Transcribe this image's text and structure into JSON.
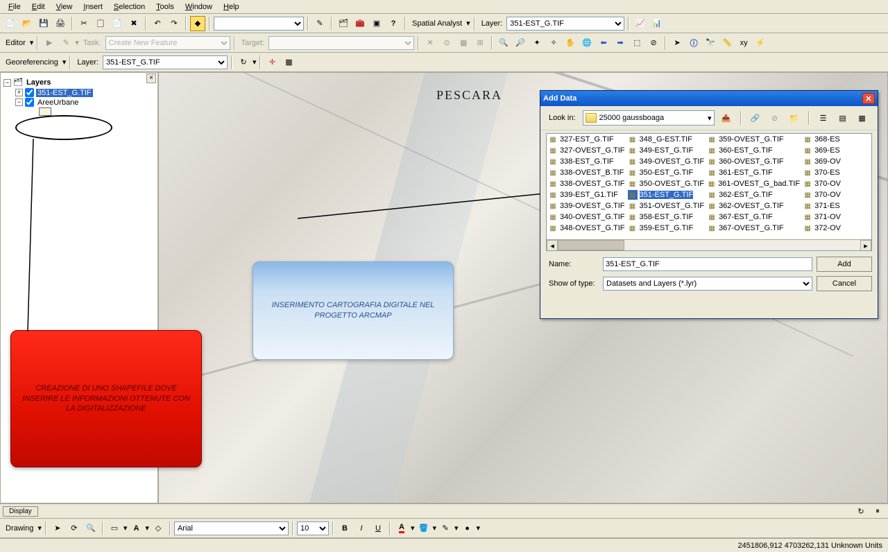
{
  "menu": {
    "file": "File",
    "edit": "Edit",
    "view": "View",
    "insert": "Insert",
    "selection": "Selection",
    "tools": "Tools",
    "window": "Window",
    "help": "Help"
  },
  "toolbar1": {
    "spatial_analyst": "Spatial Analyst",
    "layer_label": "Layer:",
    "layer_value": "351-EST_G.TIF"
  },
  "toolbar2": {
    "editor": "Editor",
    "task": "Task:",
    "task_value": "Create New Feature",
    "target": "Target:"
  },
  "toolbar3": {
    "georef": "Georeferencing",
    "layer_label": "Layer:",
    "layer_value": "351-EST_G.TIF"
  },
  "toc": {
    "root": "Layers",
    "item1": "351-EST_G.TIF",
    "item2": "AreeUrbane"
  },
  "map": {
    "city": "PESCARA"
  },
  "callout_blue": "INSERIMENTO CARTOGRAFIA DIGITALE NEL PROGETTO ARCMAP",
  "callout_red": "CREAZIONE DI UNO SHAPEFILE DOVE INSERIRE LE INFORMAZIONI OTTENUTE CON LA DIGITALIZZAZIONE",
  "dialog": {
    "title": "Add Data",
    "lookin": "Look in:",
    "folder": "25000 gaussboaga",
    "name_label": "Name:",
    "name_value": "351-EST_G.TIF",
    "type_label": "Show of type:",
    "type_value": "Datasets and Layers (*.lyr)",
    "add": "Add",
    "cancel": "Cancel",
    "files": [
      [
        "327-EST_G.TIF",
        "327-OVEST_G.TIF",
        "338-EST_G.TIF",
        "338-OVEST_B.TIF",
        "338-OVEST_G.TIF",
        "339-EST_G1.TIF",
        "339-OVEST_G.TIF",
        "340-OVEST_G.TIF",
        "348-OVEST_G.TIF"
      ],
      [
        "348_G-EST.TIF",
        "349-EST_G.TIF",
        "349-OVEST_G.TIF",
        "350-EST_G.TIF",
        "350-OVEST_G.TIF",
        "351-EST_G.TIF",
        "351-OVEST_G.TIF",
        "358-EST_G.TIF",
        "359-EST_G.TIF"
      ],
      [
        "359-OVEST_G.TIF",
        "360-EST_G.TIF",
        "360-OVEST_G.TIF",
        "361-EST_G.TIF",
        "361-OVEST_G_bad.TIF",
        "362-EST_G.TIF",
        "362-OVEST_G.TIF",
        "367-EST_G.TIF",
        "367-OVEST_G.TIF"
      ],
      [
        "368-ES",
        "369-ES",
        "369-OV",
        "370-ES",
        "370-OV",
        "370-OV",
        "371-ES",
        "371-OV",
        "372-OV"
      ]
    ],
    "selected": "351-EST_G.TIF"
  },
  "drawing": {
    "label": "Drawing",
    "font": "Arial",
    "size": "10"
  },
  "tabs": {
    "display": "Display"
  },
  "status": "2451806,912  4703262,131 Unknown Units"
}
